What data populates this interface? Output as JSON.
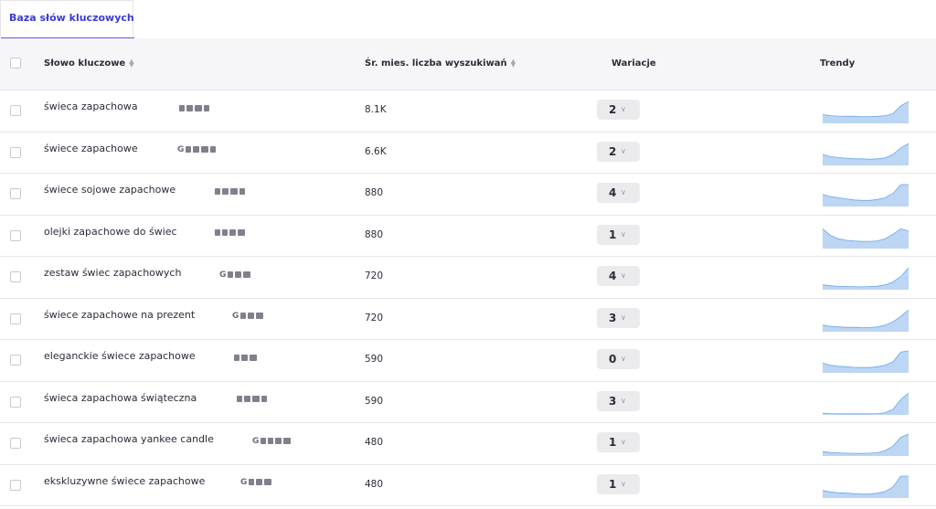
{
  "tab": {
    "label": "Baza słów kluczowych"
  },
  "columns": {
    "keyword": "Słowo kluczowe",
    "volume": "Śr. mies. liczba wyszukiwań",
    "variations": "Wariacje",
    "trends": "Trendy"
  },
  "colors": {
    "accent": "#3b3bd6",
    "trend_fill": "#bcd6f3",
    "trend_line": "#6da7e6"
  },
  "rows": [
    {
      "keyword": "świeca zapachowa",
      "volume": "8.1K",
      "variations": "2",
      "icons": [
        "image-icon",
        "shopping-bag-icon",
        "filter-icon",
        "video-icon"
      ],
      "trend": [
        0.4,
        0.35,
        0.33,
        0.32,
        0.33,
        0.3,
        0.31,
        0.32,
        0.35,
        0.45,
        0.8,
        1.0
      ]
    },
    {
      "keyword": "świece zapachowe",
      "volume": "6.6K",
      "variations": "2",
      "icons": [
        "google-icon",
        "image-icon",
        "shopping-bag-icon",
        "filter-icon",
        "video-icon"
      ],
      "trend": [
        0.5,
        0.4,
        0.36,
        0.33,
        0.3,
        0.3,
        0.28,
        0.3,
        0.34,
        0.5,
        0.8,
        1.0
      ]
    },
    {
      "keyword": "świece sojowe zapachowe",
      "volume": "880",
      "variations": "4",
      "icons": [
        "image-icon",
        "shopping-bag-icon",
        "filter-icon",
        "video-icon"
      ],
      "trend": [
        0.55,
        0.45,
        0.4,
        0.35,
        0.3,
        0.28,
        0.28,
        0.32,
        0.4,
        0.6,
        1.0,
        1.0
      ]
    },
    {
      "keyword": "olejki zapachowe do świec",
      "volume": "880",
      "variations": "1",
      "icons": [
        "image-icon",
        "chat-icon",
        "shopping-bag-icon",
        "filter-icon"
      ],
      "trend": [
        0.9,
        0.6,
        0.45,
        0.38,
        0.35,
        0.33,
        0.33,
        0.35,
        0.45,
        0.65,
        0.9,
        0.8
      ]
    },
    {
      "keyword": "zestaw świec zapachowych",
      "volume": "720",
      "variations": "4",
      "icons": [
        "google-icon",
        "image-icon",
        "shopping-bag-icon",
        "filter-icon"
      ],
      "trend": [
        0.22,
        0.18,
        0.15,
        0.15,
        0.14,
        0.13,
        0.14,
        0.16,
        0.22,
        0.35,
        0.6,
        1.0
      ]
    },
    {
      "keyword": "świece zapachowe na prezent",
      "volume": "720",
      "variations": "3",
      "icons": [
        "google-icon",
        "image-icon",
        "shopping-bag-icon",
        "filter-icon"
      ],
      "trend": [
        0.3,
        0.25,
        0.22,
        0.2,
        0.2,
        0.18,
        0.19,
        0.22,
        0.3,
        0.45,
        0.7,
        1.0
      ]
    },
    {
      "keyword": "eleganckie świece zapachowe",
      "volume": "590",
      "variations": "0",
      "icons": [
        "image-icon",
        "shopping-bag-icon",
        "filter-icon"
      ],
      "trend": [
        0.45,
        0.35,
        0.3,
        0.28,
        0.25,
        0.24,
        0.24,
        0.28,
        0.35,
        0.5,
        0.95,
        1.0
      ]
    },
    {
      "keyword": "świeca zapachowa świąteczna",
      "volume": "590",
      "variations": "3",
      "icons": [
        "image-icon",
        "shopping-bag-icon",
        "filter-icon",
        "video-icon"
      ],
      "trend": [
        0.08,
        0.06,
        0.05,
        0.05,
        0.05,
        0.05,
        0.05,
        0.06,
        0.1,
        0.25,
        0.7,
        1.0
      ]
    },
    {
      "keyword": "świeca zapachowa yankee candle",
      "volume": "480",
      "variations": "1",
      "icons": [
        "google-icon",
        "image-icon",
        "map-icon",
        "shopping-bag-icon",
        "filter-icon"
      ],
      "trend": [
        0.2,
        0.16,
        0.14,
        0.13,
        0.12,
        0.12,
        0.13,
        0.15,
        0.25,
        0.45,
        0.85,
        1.0
      ]
    },
    {
      "keyword": "ekskluzywne świece zapachowe",
      "volume": "480",
      "variations": "1",
      "icons": [
        "google-icon",
        "image-icon",
        "shopping-bag-icon",
        "filter-icon"
      ],
      "trend": [
        0.35,
        0.28,
        0.24,
        0.22,
        0.2,
        0.18,
        0.18,
        0.22,
        0.3,
        0.5,
        1.0,
        1.0
      ]
    }
  ]
}
